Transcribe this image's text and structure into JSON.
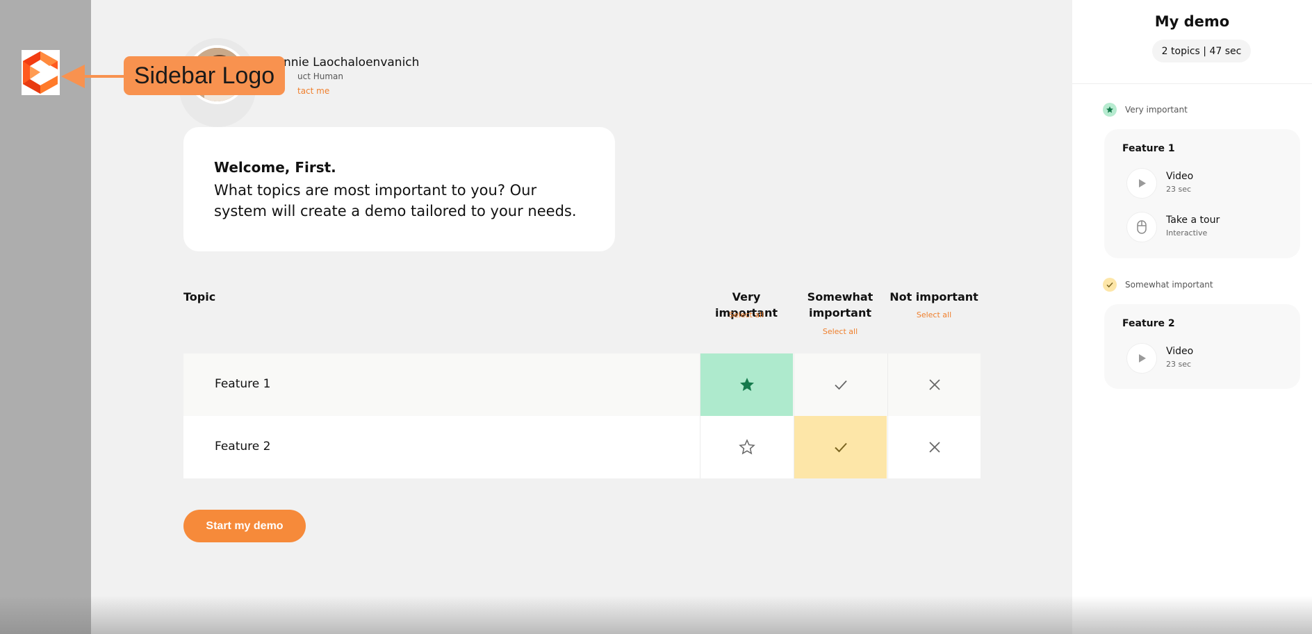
{
  "annotation": {
    "callout_text": "Sidebar Logo"
  },
  "host": {
    "name": "nnie Laochaloenvanich",
    "role": "uct Human",
    "contact": "tact me"
  },
  "welcome": {
    "heading": "Welcome, First.",
    "message": "What topics are most important to you? Our system will create a demo tailored to your needs."
  },
  "table": {
    "col_topic": "Topic",
    "col_very": "Very important",
    "col_some_line1": "Somewhat",
    "col_some_line2": "important",
    "col_not": "Not important",
    "select_all": "Select all",
    "rows": [
      {
        "label": "Feature 1",
        "selected": "very"
      },
      {
        "label": "Feature 2",
        "selected": "somewhat"
      }
    ]
  },
  "start_button": "Start my demo",
  "panel": {
    "title": "My demo",
    "summary": "2 topics | 47 sec",
    "groups": [
      {
        "label": "Very important",
        "feature": "Feature 1",
        "items": [
          {
            "title": "Video",
            "sub": "23 sec",
            "icon": "play-icon"
          },
          {
            "title": "Take a tour",
            "sub": "Interactive",
            "icon": "mouse-icon"
          }
        ]
      },
      {
        "label": "Somewhat important",
        "feature": "Feature 2",
        "items": [
          {
            "title": "Video",
            "sub": "23 sec",
            "icon": "play-icon"
          }
        ]
      }
    ]
  },
  "colors": {
    "accent": "#f68a3a",
    "very_bg": "#aeeacd",
    "very_fg": "#157a4c",
    "some_bg": "#fde6a8",
    "some_fg": "#7a6420"
  }
}
